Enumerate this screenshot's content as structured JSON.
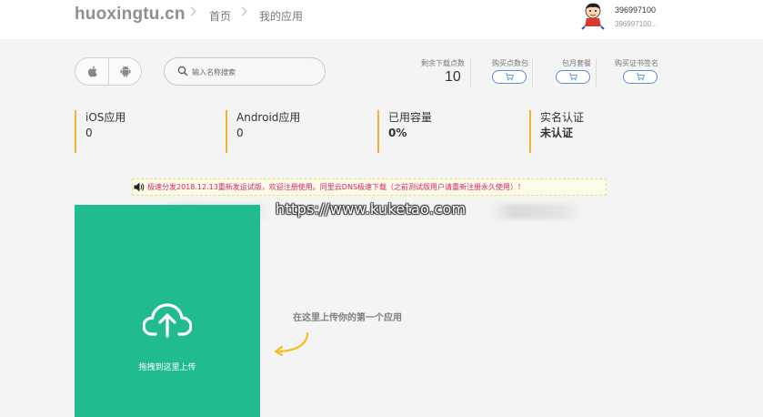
{
  "header": {
    "logo": "huoxingtu.cn",
    "breadcrumb": [
      "首页",
      "我的应用"
    ],
    "user": {
      "name": "396997100",
      "sub": "396997100..."
    }
  },
  "toolbar": {
    "platforms": [
      {
        "name": "ios",
        "icon": "apple-icon"
      },
      {
        "name": "android",
        "icon": "android-icon"
      }
    ],
    "search_placeholder": "输入名称搜索"
  },
  "stats": {
    "downloads_label": "剩余下载点数",
    "downloads_value": "10",
    "buy_downloads_label": "购买点数包",
    "monthly_label": "包月套餐",
    "buy_cert_label": "购买证书签名",
    "cart_icon": "cart-icon",
    "accent": "#5b8fd4"
  },
  "cards": [
    {
      "title": "iOS应用",
      "value": "0",
      "bold": false
    },
    {
      "title": "Android应用",
      "value": "0",
      "bold": false
    },
    {
      "title": "已用容量",
      "value": "0%",
      "bold": true
    },
    {
      "title": "实名认证",
      "value": "未认证",
      "bold": true
    }
  ],
  "notice": {
    "text": "极速分发2018.12.13重新发运试版，欢迎注册使用。同里云DNS极速下载（之前测试版用户请重新注册永久使用）！",
    "color": "#d6246a"
  },
  "watermark": "https://www.kuketao.com",
  "upload": {
    "label": "拖拽到这里上传",
    "hint": "在这里上传你的第一个应用",
    "color": "#21bb92"
  }
}
